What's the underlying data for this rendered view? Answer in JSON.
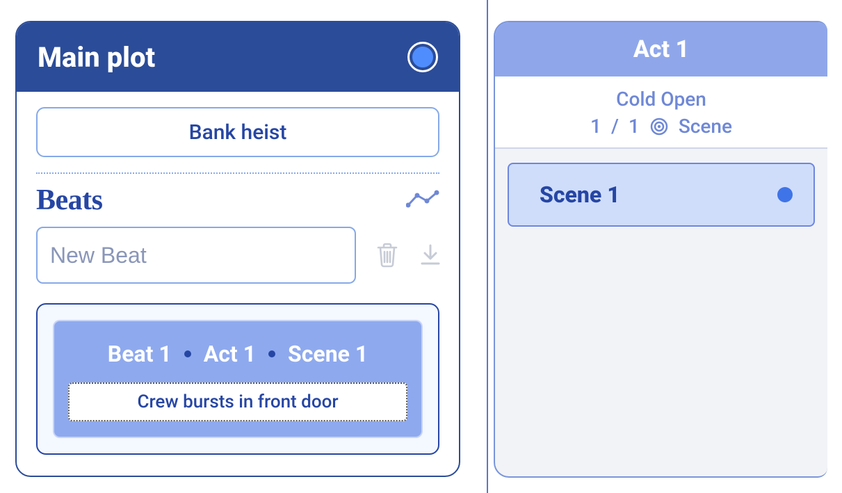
{
  "plot": {
    "header_title": "Main plot",
    "color": "#4f8dff",
    "title_value": "Bank heist",
    "beats_heading": "Beats",
    "new_beat_placeholder": "New Beat",
    "beat_card": {
      "beat_label": "Beat 1",
      "act_label": "Act 1",
      "scene_label": "Scene 1",
      "description": "Crew bursts in front door"
    }
  },
  "scene_panel": {
    "act_title": "Act 1",
    "section_name": "Cold Open",
    "count_current": "1",
    "count_sep": "/",
    "count_total": "1",
    "scene_word": "Scene",
    "scenes": [
      {
        "label": "Scene 1"
      }
    ]
  }
}
